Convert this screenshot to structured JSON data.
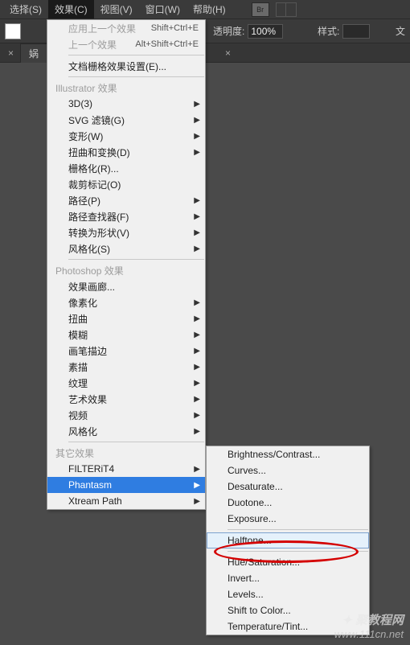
{
  "menubar": {
    "items": [
      "选择(S)",
      "效果(C)",
      "视图(V)",
      "窗口(W)",
      "帮助(H)"
    ],
    "active_index": 1,
    "br_label": "Br"
  },
  "toolbar": {
    "opacity_label": "透明度:",
    "opacity_value": "100%",
    "style_label": "样式:",
    "doc_label": "文"
  },
  "tabs": {
    "items": [
      {
        "label": "娲",
        "close": "×"
      }
    ],
    "stray_close": "×"
  },
  "menu_effects": {
    "top_items": [
      {
        "label": "应用上一个效果",
        "shortcut": "Shift+Ctrl+E"
      },
      {
        "label": "上一个效果",
        "shortcut": "Alt+Shift+Ctrl+E"
      }
    ],
    "doc_raster": "文档栅格效果设置(E)...",
    "section1_title": "Illustrator 效果",
    "section1_items": [
      {
        "label": "3D(3)",
        "arrow": true
      },
      {
        "label": "SVG 滤镜(G)",
        "arrow": true
      },
      {
        "label": "变形(W)",
        "arrow": true
      },
      {
        "label": "扭曲和变换(D)",
        "arrow": true
      },
      {
        "label": "栅格化(R)..."
      },
      {
        "label": "裁剪标记(O)"
      },
      {
        "label": "路径(P)",
        "arrow": true
      },
      {
        "label": "路径查找器(F)",
        "arrow": true
      },
      {
        "label": "转换为形状(V)",
        "arrow": true
      },
      {
        "label": "风格化(S)",
        "arrow": true
      }
    ],
    "section2_title": "Photoshop 效果",
    "section2_items": [
      {
        "label": "效果画廊..."
      },
      {
        "label": "像素化",
        "arrow": true
      },
      {
        "label": "扭曲",
        "arrow": true
      },
      {
        "label": "模糊",
        "arrow": true
      },
      {
        "label": "画笔描边",
        "arrow": true
      },
      {
        "label": "素描",
        "arrow": true
      },
      {
        "label": "纹理",
        "arrow": true
      },
      {
        "label": "艺术效果",
        "arrow": true
      },
      {
        "label": "视频",
        "arrow": true
      },
      {
        "label": "风格化",
        "arrow": true
      }
    ],
    "section3_title": "其它效果",
    "section3_items": [
      {
        "label": "FILTERiT4",
        "arrow": true
      },
      {
        "label": "Phantasm",
        "arrow": true,
        "highlight": true
      },
      {
        "label": "Xtream Path",
        "arrow": true
      }
    ]
  },
  "menu_sub": {
    "items": [
      {
        "label": "Brightness/Contrast..."
      },
      {
        "label": "Curves..."
      },
      {
        "label": "Desaturate..."
      },
      {
        "label": "Duotone..."
      },
      {
        "label": "Exposure..."
      },
      {
        "label": "Halftone...",
        "hover": true,
        "circled": true
      },
      {
        "label": "Hue/Saturation..."
      },
      {
        "label": "Invert..."
      },
      {
        "label": "Levels..."
      },
      {
        "label": "Shift to Color..."
      },
      {
        "label": "Temperature/Tint..."
      }
    ]
  },
  "watermark": {
    "line1": "✦ 聚教程网",
    "line2": "www.111cn.net"
  }
}
